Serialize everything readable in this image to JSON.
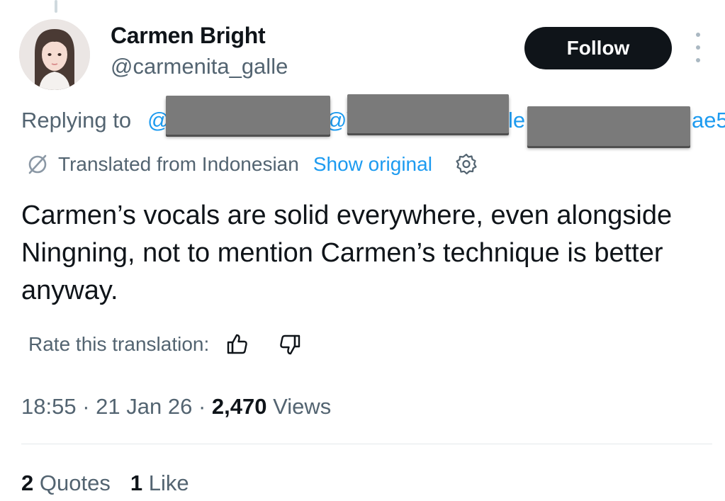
{
  "author": {
    "display_name": "Carmen Bright",
    "handle": "@carmenita_galle",
    "avatar_icon": "profile-photo"
  },
  "follow_button": {
    "label": "Follow"
  },
  "more_menu": {
    "icon": "more-vertical-icon"
  },
  "reply_context": {
    "label": "Replying to",
    "mention_fragments": [
      "@",
      "@\\",
      "le",
      "ae5"
    ]
  },
  "translation": {
    "label": "Translated from Indonesian",
    "show_original_label": "Show original",
    "icon": "translate-icon",
    "settings_icon": "settings-gear-icon"
  },
  "tweet": {
    "text": "Carmen’s vocals are solid everywhere, even alongside Ningning, not to mention Carmen’s technique is better anyway."
  },
  "rate_translation": {
    "label": "Rate this translation:",
    "thumbs_up_icon": "thumbs-up-icon",
    "thumbs_down_icon": "thumbs-down-icon"
  },
  "meta": {
    "time": "18:55",
    "separator": "·",
    "date": "21 Jan 26",
    "views_count": "2,470",
    "views_label": "Views"
  },
  "stats": {
    "quotes_count": "2",
    "quotes_label": "Quotes",
    "likes_count": "1",
    "likes_label": "Like"
  },
  "colors": {
    "link_blue": "#1d9bf0",
    "text_primary": "#0f1419",
    "text_secondary": "#536471",
    "button_dark": "#0f1419",
    "redaction_gray": "#7a7a7a"
  }
}
